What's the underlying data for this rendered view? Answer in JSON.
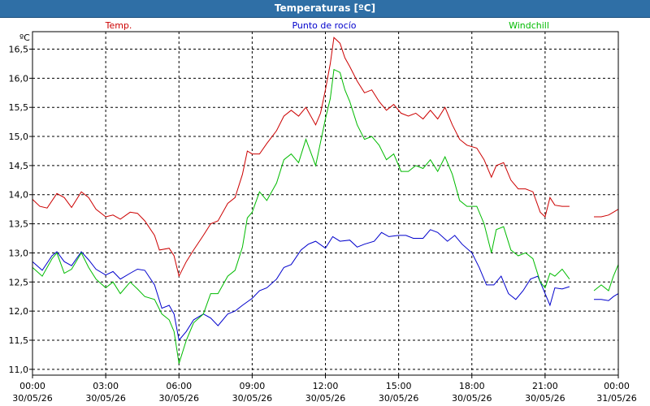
{
  "chart_data": {
    "type": "line",
    "title": "Temperaturas [ºC]",
    "ylabel": "ºC",
    "xlabel": "",
    "ylim": [
      10.9,
      16.8
    ],
    "xlim": [
      0,
      24
    ],
    "grid": true,
    "yticks": [
      11.0,
      11.5,
      12.0,
      12.5,
      13.0,
      13.5,
      14.0,
      14.5,
      15.0,
      15.5,
      16.0,
      16.5
    ],
    "ytick_labels": [
      "11,0",
      "11,5",
      "12,0",
      "12,5",
      "13,0",
      "13,5",
      "14,0",
      "14,5",
      "15,0",
      "15,5",
      "16,0",
      "16,5"
    ],
    "xticks": [
      0,
      3,
      6,
      9,
      12,
      15,
      18,
      21,
      24
    ],
    "xtick_labels": [
      {
        "time": "00:00",
        "date": "30/05/26"
      },
      {
        "time": "03:00",
        "date": "30/05/26"
      },
      {
        "time": "06:00",
        "date": "30/05/26"
      },
      {
        "time": "09:00",
        "date": "30/05/26"
      },
      {
        "time": "12:00",
        "date": "30/05/26"
      },
      {
        "time": "15:00",
        "date": "30/05/26"
      },
      {
        "time": "18:00",
        "date": "30/05/26"
      },
      {
        "time": "21:00",
        "date": "30/05/26"
      },
      {
        "time": "00:00",
        "date": "31/05/26"
      }
    ],
    "series": [
      {
        "name": "Temp.",
        "color": "#cc0000",
        "points": [
          [
            0,
            13.92
          ],
          [
            0.3,
            13.8
          ],
          [
            0.6,
            13.77
          ],
          [
            1.0,
            14.02
          ],
          [
            1.3,
            13.95
          ],
          [
            1.6,
            13.78
          ],
          [
            2.0,
            14.05
          ],
          [
            2.3,
            13.95
          ],
          [
            2.6,
            13.75
          ],
          [
            3.0,
            13.62
          ],
          [
            3.3,
            13.65
          ],
          [
            3.6,
            13.58
          ],
          [
            4.0,
            13.7
          ],
          [
            4.3,
            13.68
          ],
          [
            4.6,
            13.55
          ],
          [
            5.0,
            13.3
          ],
          [
            5.2,
            13.05
          ],
          [
            5.6,
            13.08
          ],
          [
            5.8,
            12.95
          ],
          [
            6.0,
            12.6
          ],
          [
            6.3,
            12.85
          ],
          [
            6.6,
            13.05
          ],
          [
            7.0,
            13.3
          ],
          [
            7.3,
            13.5
          ],
          [
            7.6,
            13.55
          ],
          [
            8.0,
            13.85
          ],
          [
            8.3,
            13.95
          ],
          [
            8.6,
            14.35
          ],
          [
            8.8,
            14.75
          ],
          [
            9.0,
            14.7
          ],
          [
            9.3,
            14.7
          ],
          [
            9.6,
            14.88
          ],
          [
            10.0,
            15.1
          ],
          [
            10.3,
            15.35
          ],
          [
            10.6,
            15.45
          ],
          [
            10.9,
            15.35
          ],
          [
            11.2,
            15.5
          ],
          [
            11.6,
            15.2
          ],
          [
            11.8,
            15.4
          ],
          [
            12.0,
            15.8
          ],
          [
            12.2,
            16.25
          ],
          [
            12.35,
            16.7
          ],
          [
            12.6,
            16.6
          ],
          [
            12.8,
            16.35
          ],
          [
            13.0,
            16.2
          ],
          [
            13.3,
            15.95
          ],
          [
            13.6,
            15.75
          ],
          [
            13.9,
            15.8
          ],
          [
            14.2,
            15.6
          ],
          [
            14.5,
            15.45
          ],
          [
            14.8,
            15.55
          ],
          [
            15.1,
            15.4
          ],
          [
            15.4,
            15.35
          ],
          [
            15.7,
            15.4
          ],
          [
            16.0,
            15.3
          ],
          [
            16.3,
            15.45
          ],
          [
            16.6,
            15.3
          ],
          [
            16.9,
            15.5
          ],
          [
            17.2,
            15.2
          ],
          [
            17.5,
            14.95
          ],
          [
            17.8,
            14.85
          ],
          [
            18.2,
            14.8
          ],
          [
            18.5,
            14.6
          ],
          [
            18.8,
            14.3
          ],
          [
            19.0,
            14.5
          ],
          [
            19.3,
            14.55
          ],
          [
            19.6,
            14.25
          ],
          [
            19.9,
            14.1
          ],
          [
            20.2,
            14.1
          ],
          [
            20.5,
            14.05
          ],
          [
            20.8,
            13.7
          ],
          [
            21.0,
            13.62
          ],
          [
            21.2,
            13.95
          ],
          [
            21.4,
            13.82
          ],
          [
            21.7,
            13.8
          ],
          [
            22.0,
            13.8
          ]
        ]
      },
      {
        "name": "Temp.",
        "color": "#cc0000",
        "points": [
          [
            23.0,
            13.62
          ],
          [
            23.3,
            13.62
          ],
          [
            23.6,
            13.65
          ],
          [
            23.8,
            13.7
          ],
          [
            24.0,
            13.75
          ]
        ]
      },
      {
        "name": "Punto de rocío",
        "color": "#0000cc",
        "points": [
          [
            0,
            12.85
          ],
          [
            0.4,
            12.7
          ],
          [
            0.8,
            12.95
          ],
          [
            1.0,
            13.02
          ],
          [
            1.3,
            12.85
          ],
          [
            1.6,
            12.78
          ],
          [
            2.0,
            13.02
          ],
          [
            2.3,
            12.88
          ],
          [
            2.6,
            12.72
          ],
          [
            3.0,
            12.62
          ],
          [
            3.3,
            12.68
          ],
          [
            3.6,
            12.55
          ],
          [
            4.0,
            12.65
          ],
          [
            4.3,
            12.72
          ],
          [
            4.6,
            12.7
          ],
          [
            5.0,
            12.45
          ],
          [
            5.3,
            12.05
          ],
          [
            5.6,
            12.1
          ],
          [
            5.8,
            11.95
          ],
          [
            6.0,
            11.5
          ],
          [
            6.3,
            11.65
          ],
          [
            6.6,
            11.85
          ],
          [
            7.0,
            11.95
          ],
          [
            7.3,
            11.88
          ],
          [
            7.6,
            11.75
          ],
          [
            8.0,
            11.95
          ],
          [
            8.3,
            12.0
          ],
          [
            8.6,
            12.1
          ],
          [
            9.0,
            12.22
          ],
          [
            9.3,
            12.35
          ],
          [
            9.6,
            12.4
          ],
          [
            10.0,
            12.55
          ],
          [
            10.3,
            12.75
          ],
          [
            10.6,
            12.8
          ],
          [
            11.0,
            13.05
          ],
          [
            11.3,
            13.15
          ],
          [
            11.6,
            13.2
          ],
          [
            12.0,
            13.08
          ],
          [
            12.3,
            13.28
          ],
          [
            12.6,
            13.2
          ],
          [
            13.0,
            13.22
          ],
          [
            13.3,
            13.1
          ],
          [
            13.6,
            13.15
          ],
          [
            14.0,
            13.2
          ],
          [
            14.3,
            13.35
          ],
          [
            14.6,
            13.28
          ],
          [
            15.0,
            13.3
          ],
          [
            15.3,
            13.3
          ],
          [
            15.6,
            13.25
          ],
          [
            16.0,
            13.25
          ],
          [
            16.3,
            13.4
          ],
          [
            16.6,
            13.35
          ],
          [
            17.0,
            13.2
          ],
          [
            17.3,
            13.3
          ],
          [
            17.6,
            13.15
          ],
          [
            18.0,
            13.0
          ],
          [
            18.3,
            12.75
          ],
          [
            18.6,
            12.45
          ],
          [
            18.9,
            12.45
          ],
          [
            19.2,
            12.6
          ],
          [
            19.5,
            12.3
          ],
          [
            19.8,
            12.2
          ],
          [
            20.1,
            12.35
          ],
          [
            20.4,
            12.55
          ],
          [
            20.7,
            12.6
          ],
          [
            21.0,
            12.3
          ],
          [
            21.2,
            12.1
          ],
          [
            21.4,
            12.4
          ],
          [
            21.7,
            12.38
          ],
          [
            22.0,
            12.42
          ]
        ]
      },
      {
        "name": "Punto de rocío",
        "color": "#0000cc",
        "points": [
          [
            23.0,
            12.2
          ],
          [
            23.3,
            12.2
          ],
          [
            23.6,
            12.18
          ],
          [
            23.8,
            12.25
          ],
          [
            24.0,
            12.3
          ]
        ]
      },
      {
        "name": "Windchill",
        "color": "#00bb00",
        "points": [
          [
            0,
            12.75
          ],
          [
            0.4,
            12.6
          ],
          [
            0.8,
            12.9
          ],
          [
            1.0,
            13.0
          ],
          [
            1.3,
            12.65
          ],
          [
            1.6,
            12.72
          ],
          [
            2.0,
            13.0
          ],
          [
            2.3,
            12.75
          ],
          [
            2.6,
            12.55
          ],
          [
            3.0,
            12.4
          ],
          [
            3.3,
            12.5
          ],
          [
            3.6,
            12.3
          ],
          [
            4.0,
            12.5
          ],
          [
            4.3,
            12.38
          ],
          [
            4.6,
            12.25
          ],
          [
            5.0,
            12.2
          ],
          [
            5.3,
            11.95
          ],
          [
            5.6,
            11.85
          ],
          [
            5.8,
            11.65
          ],
          [
            6.0,
            11.1
          ],
          [
            6.3,
            11.5
          ],
          [
            6.6,
            11.8
          ],
          [
            7.0,
            11.95
          ],
          [
            7.3,
            12.3
          ],
          [
            7.6,
            12.3
          ],
          [
            8.0,
            12.6
          ],
          [
            8.3,
            12.7
          ],
          [
            8.6,
            13.1
          ],
          [
            8.8,
            13.6
          ],
          [
            9.0,
            13.7
          ],
          [
            9.3,
            14.05
          ],
          [
            9.6,
            13.9
          ],
          [
            10.0,
            14.2
          ],
          [
            10.3,
            14.6
          ],
          [
            10.6,
            14.7
          ],
          [
            10.9,
            14.55
          ],
          [
            11.2,
            14.95
          ],
          [
            11.6,
            14.5
          ],
          [
            11.8,
            14.9
          ],
          [
            12.0,
            15.3
          ],
          [
            12.2,
            15.65
          ],
          [
            12.35,
            16.15
          ],
          [
            12.6,
            16.1
          ],
          [
            12.8,
            15.8
          ],
          [
            13.0,
            15.6
          ],
          [
            13.3,
            15.2
          ],
          [
            13.6,
            14.95
          ],
          [
            13.9,
            15.0
          ],
          [
            14.2,
            14.85
          ],
          [
            14.5,
            14.6
          ],
          [
            14.8,
            14.7
          ],
          [
            15.1,
            14.4
          ],
          [
            15.4,
            14.4
          ],
          [
            15.7,
            14.5
          ],
          [
            16.0,
            14.45
          ],
          [
            16.3,
            14.6
          ],
          [
            16.6,
            14.4
          ],
          [
            16.9,
            14.65
          ],
          [
            17.2,
            14.35
          ],
          [
            17.5,
            13.9
          ],
          [
            17.8,
            13.8
          ],
          [
            18.2,
            13.8
          ],
          [
            18.5,
            13.5
          ],
          [
            18.8,
            13.0
          ],
          [
            19.0,
            13.4
          ],
          [
            19.3,
            13.45
          ],
          [
            19.6,
            13.05
          ],
          [
            19.9,
            12.95
          ],
          [
            20.2,
            13.0
          ],
          [
            20.5,
            12.9
          ],
          [
            20.8,
            12.5
          ],
          [
            21.0,
            12.4
          ],
          [
            21.2,
            12.65
          ],
          [
            21.4,
            12.6
          ],
          [
            21.7,
            12.72
          ],
          [
            22.0,
            12.55
          ]
        ]
      },
      {
        "name": "Windchill",
        "color": "#00bb00",
        "points": [
          [
            23.0,
            12.35
          ],
          [
            23.3,
            12.45
          ],
          [
            23.6,
            12.35
          ],
          [
            23.8,
            12.6
          ],
          [
            24.0,
            12.8
          ]
        ]
      }
    ],
    "legend": [
      {
        "label": "Temp.",
        "color": "#cc0000"
      },
      {
        "label": "Punto de rocío",
        "color": "#0000cc"
      },
      {
        "label": "Windchill",
        "color": "#00bb00"
      }
    ]
  }
}
